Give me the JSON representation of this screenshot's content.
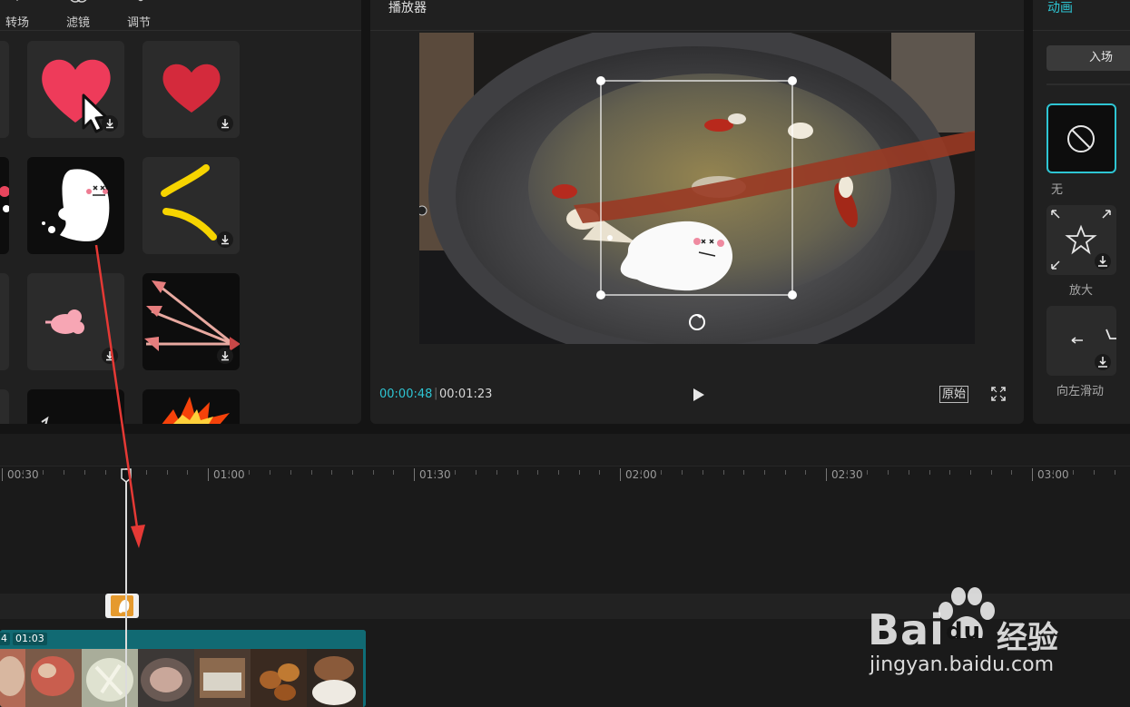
{
  "library": {
    "tabs": [
      {
        "label": "转场",
        "icon": "transition-icon"
      },
      {
        "label": "滤镜",
        "icon": "filter-icon"
      },
      {
        "label": "调节",
        "icon": "adjust-icon"
      }
    ],
    "stickers": [
      {
        "name": "heart-cursor-sticker",
        "download": true
      },
      {
        "name": "red-heart-sticker",
        "download": true
      },
      {
        "name": "ghost-sticker",
        "download": false
      },
      {
        "name": "yellow-lines-sticker",
        "download": true
      },
      {
        "name": "pink-cloud-sticker",
        "download": true
      },
      {
        "name": "arrows-sticker",
        "download": true
      },
      {
        "name": "dark-sticker",
        "download": false
      },
      {
        "name": "explosion-sticker",
        "download": false
      }
    ]
  },
  "player": {
    "title": "播放器",
    "current_time": "00:00:48",
    "total_time": "00:01:23",
    "ratio_label": "原始",
    "icons": {
      "play": "play-icon",
      "fullscreen": "fullscreen-icon",
      "rotate": "rotate-icon"
    }
  },
  "animation": {
    "title": "动画",
    "tab": "入场",
    "items": [
      {
        "label": "无",
        "icon": "none-icon",
        "selected": true
      },
      {
        "label": "放大",
        "icon": "zoom-in-star-icon",
        "selected": false
      },
      {
        "label": "向左滑动",
        "icon": "slide-left-icon",
        "selected": false
      }
    ]
  },
  "timeline": {
    "ruler_marks": [
      "00:30",
      "01:00",
      "01:30",
      "02:00",
      "02:30",
      "03:00"
    ],
    "video_clip": {
      "badge_left": "4",
      "badge_duration": "01:03"
    }
  },
  "watermark": {
    "brand": "Bai",
    "brand_suffix": "du",
    "brand_zh": "经验",
    "url": "jingyan.baidu.com"
  },
  "colors": {
    "accent": "#2ec5d3",
    "panel": "#202020",
    "background": "#141414",
    "arrow": "#e53935",
    "clip": "#0e6e78",
    "sticker_clip": "#e59a2e"
  }
}
